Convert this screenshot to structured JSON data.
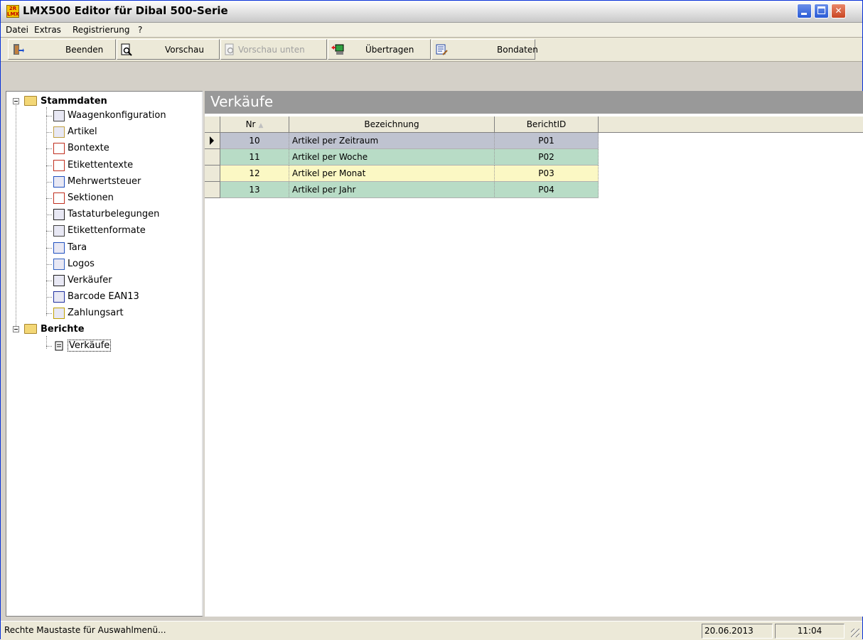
{
  "window": {
    "title": "LMX500 Editor für Dibal 500-Serie",
    "app_icon_text": "2R LMX"
  },
  "menu": [
    "Datei",
    "Extras",
    "Registrierung",
    "?"
  ],
  "toolbar": {
    "beenden": "Beenden",
    "vorschau": "Vorschau",
    "vorschau_unten": "Vorschau unten",
    "uebertragen": "Übertragen",
    "bondaten": "Bondaten"
  },
  "tree": {
    "stammdaten": {
      "label": "Stammdaten",
      "items": [
        "Waagenkonfiguration",
        "Artikel",
        "Bontexte",
        "Etikettentexte",
        "Mehrwertsteuer",
        "Sektionen",
        "Tastaturbelegungen",
        "Etikettenformate",
        "Tara",
        "Logos",
        "Verkäufer",
        "Barcode EAN13",
        "Zahlungsart"
      ]
    },
    "berichte": {
      "label": "Berichte",
      "items": [
        "Verkäufe"
      ]
    }
  },
  "content": {
    "title": "Verkäufe",
    "columns": [
      "Nr",
      "Bezeichnung",
      "BerichtID"
    ],
    "rows": [
      {
        "nr": "10",
        "bez": "Artikel per Zeitraum",
        "id": "P01",
        "color": "#bfc3d0"
      },
      {
        "nr": "11",
        "bez": "Artikel per Woche",
        "id": "P02",
        "color": "#b8dcc6"
      },
      {
        "nr": "12",
        "bez": "Artikel per Monat",
        "id": "P03",
        "color": "#fbf8c4"
      },
      {
        "nr": "13",
        "bez": "Artikel per Jahr",
        "id": "P04",
        "color": "#b8dcc6"
      }
    ]
  },
  "status": {
    "hint": "Rechte Maustaste für Auswahlmenü...",
    "date": "20.06.2013",
    "time": "11:04"
  }
}
